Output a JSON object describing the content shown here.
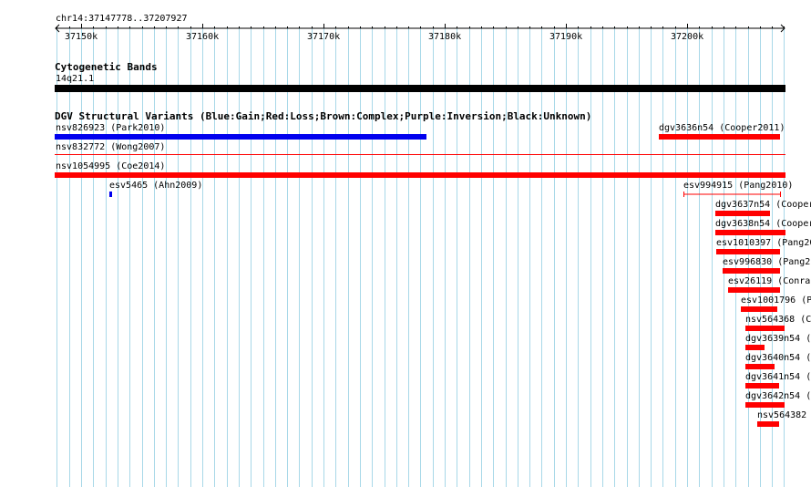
{
  "ruler": {
    "range_label": "chr14:37147778..37207927",
    "start": 37147778,
    "end": 37207927,
    "tick_labels": [
      "37150k",
      "37160k",
      "37170k",
      "37180k",
      "37190k",
      "37200k"
    ]
  },
  "cytoband_track": {
    "title": "Cytogenetic Bands",
    "band_label": "14q21.1"
  },
  "dgv_track": {
    "title": "DGV Structural Variants (Blue:Gain;Red:Loss;Brown:Complex;Purple:Inversion;Black:Unknown)",
    "features": [
      {
        "id": "nsv826923",
        "label": "nsv826923 (Park2010)",
        "type": "gain"
      },
      {
        "id": "dgv3636n54",
        "label": "dgv3636n54 (Cooper2011)",
        "type": "loss"
      },
      {
        "id": "nsv832772",
        "label": "nsv832772 (Wong2007)",
        "type": "loss"
      },
      {
        "id": "nsv1054995",
        "label": "nsv1054995 (Coe2014)",
        "type": "loss"
      },
      {
        "id": "esv5465",
        "label": "esv5465 (Ahn2009)",
        "type": "gain"
      },
      {
        "id": "esv994915",
        "label": "esv994915 (Pang2010)",
        "type": "loss"
      },
      {
        "id": "dgv3637n54",
        "label": "dgv3637n54 (Cooper",
        "type": "loss"
      },
      {
        "id": "dgv3638n54",
        "label": "dgv3638n54 (Cooper",
        "type": "loss"
      },
      {
        "id": "esv1010397",
        "label": "esv1010397 (Pang20",
        "type": "loss"
      },
      {
        "id": "esv996830",
        "label": "esv996830 (Pang20",
        "type": "loss"
      },
      {
        "id": "esv26119",
        "label": "esv26119 (Conrac",
        "type": "loss"
      },
      {
        "id": "esv1001796",
        "label": "esv1001796 (P",
        "type": "loss"
      },
      {
        "id": "nsv564368",
        "label": "nsv564368 (C",
        "type": "loss"
      },
      {
        "id": "dgv3639n54",
        "label": "dgv3639n54 (",
        "type": "loss"
      },
      {
        "id": "dgv3640n54",
        "label": "dgv3640n54 (",
        "type": "loss"
      },
      {
        "id": "dgv3641n54",
        "label": "dgv3641n54 (",
        "type": "loss"
      },
      {
        "id": "dgv3642n54",
        "label": "dgv3642n54 (",
        "type": "loss"
      },
      {
        "id": "nsv564382",
        "label": "nsv564382",
        "type": "loss"
      }
    ]
  },
  "colors": {
    "gain": "#0000ee",
    "loss": "#ff0000",
    "cytoband": "#000000",
    "grid_line": "#a8d8e8",
    "ruler": "#000000"
  }
}
